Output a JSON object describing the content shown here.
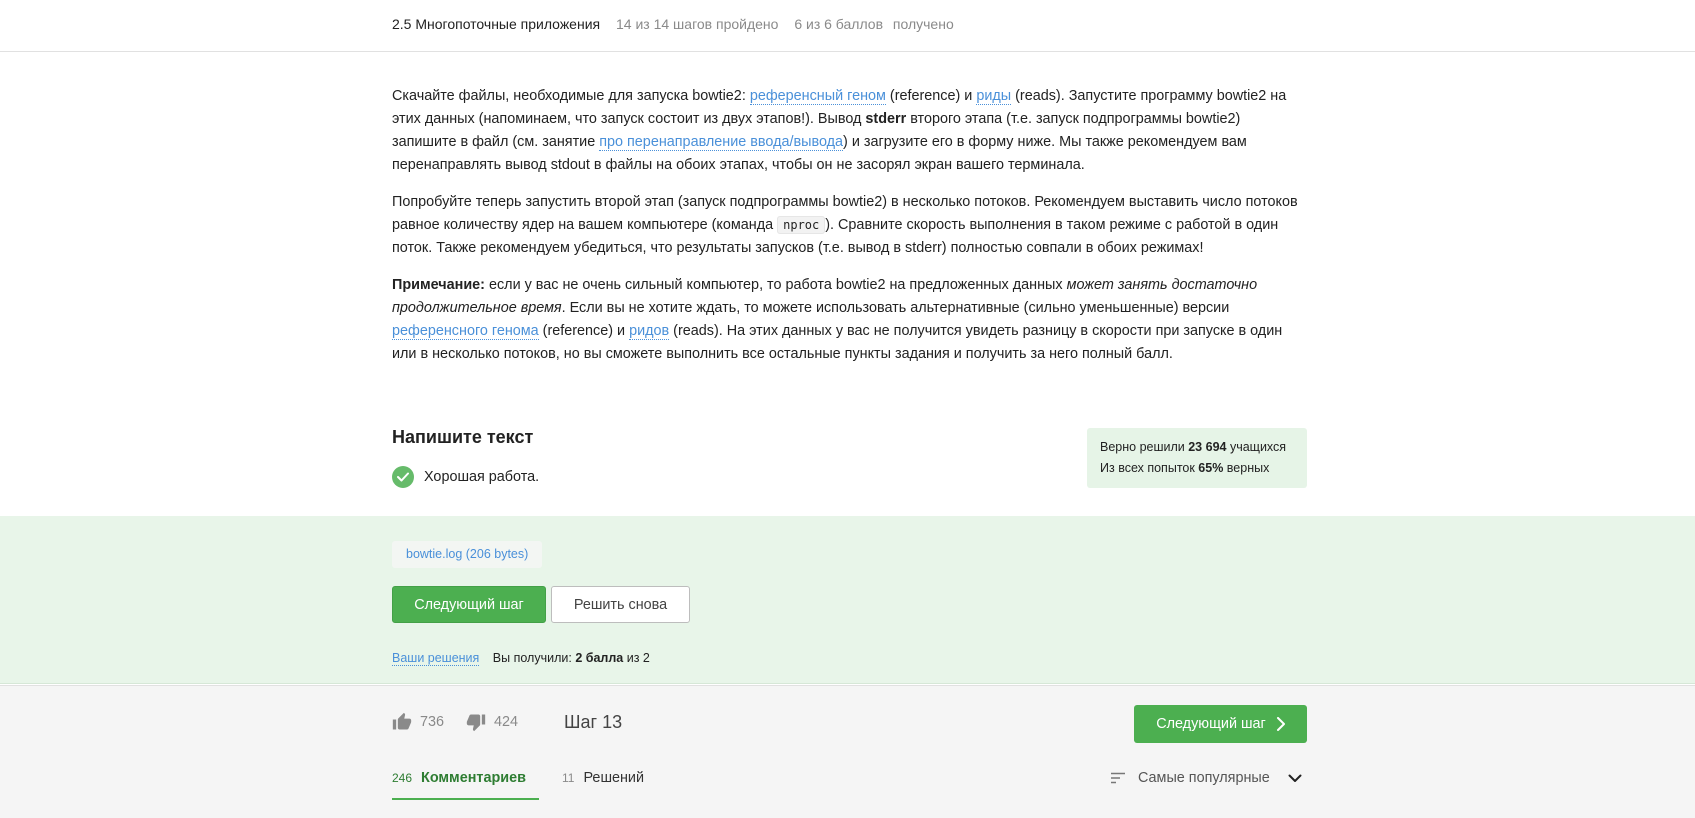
{
  "header": {
    "lesson_title": "2.5 Многопоточные приложения",
    "steps_progress": "14 из 14 шагов пройдено",
    "score": "6 из 6 баллов",
    "score_suffix": "получено"
  },
  "content": {
    "p1": {
      "t1": "Скачайте файлы, необходимые для запуска bowtie2: ",
      "link_genome": "референсный геном",
      "t2": " (reference) и ",
      "link_reads": "риды",
      "t3": " (reads). Запустите программу bowtie2 на этих данных (напоминаем, что запуск состоит из двух этапов!). Вывод ",
      "bold_stderr": "stderr",
      "t4": " второго этапа (т.е. запуск подпрограммы bowtie2) запишите в файл (см. занятие ",
      "link_redirect": "про перенаправление ввода/вывода",
      "t5": ") и загрузите его в форму ниже. Мы также рекомендуем вам перенаправлять вывод stdout в файлы на обоих этапах, чтобы он не засорял экран вашего терминала."
    },
    "p2": {
      "t1": "Попробуйте теперь запустить второй этап (запуск подпрограммы bowtie2) в несколько потоков. Рекомендуем выставить число потоков равное количеству ядер на вашем компьютере (команда ",
      "code": "nproc",
      "t2": "). Сравните скорость выполнения в таком режиме с работой в один поток. Также рекомендуем убедиться, что результаты запусков (т.е. вывод в stderr) полностью совпали в обоих режимах!"
    },
    "p3": {
      "bold": "Примечание:",
      "t1": " если у вас не очень сильный компьютер, то работа bowtie2 на предложенных данных ",
      "italic": "может занять достаточно продолжительное время",
      "t2": ". Если вы не хотите ждать, то можете использовать альтернативные (сильно уменьшенные) версии ",
      "link_genome": "референсного генома",
      "t3": " (reference) и ",
      "link_reads": "ридов",
      "t4": " (reads). На этих данных у вас не получится увидеть разницу в скорости при запуске в один или в несколько потоков, но вы сможете выполнить все остальные пункты задания и получить за него полный балл."
    }
  },
  "task": {
    "title": "Напишите текст",
    "feedback": "Хорошая работа."
  },
  "stats": {
    "solved_prefix": "Верно решили ",
    "solved_count": "23 694",
    "solved_suffix": " учащихся",
    "attempts_prefix": "Из всех попыток ",
    "attempts_percent": "65%",
    "attempts_suffix": " верных"
  },
  "submission": {
    "file_label": "bowtie.log (206 bytes)",
    "next_button": "Следующий шаг",
    "retry_button": "Решить снова",
    "your_solutions_link": "Ваши решения",
    "result_prefix": "Вы получили: ",
    "result_points": "2 балла",
    "result_suffix": " из 2"
  },
  "footer": {
    "likes": "736",
    "dislikes": "424",
    "step_label": "Шаг 13",
    "next_button": "Следующий шаг",
    "tabs": [
      {
        "count": "246",
        "label": "Комментариев"
      },
      {
        "count": "11",
        "label": "Решений"
      }
    ],
    "sort_label": "Самые популярные"
  },
  "colors": {
    "accent_green": "#4caf50",
    "link_blue": "#4a90d9",
    "success_bg": "#e8f5e9"
  },
  "icons": [
    "check-icon",
    "thumbs-up-icon",
    "thumbs-down-icon",
    "chevron-right-icon",
    "sort-icon",
    "chevron-down-icon"
  ]
}
